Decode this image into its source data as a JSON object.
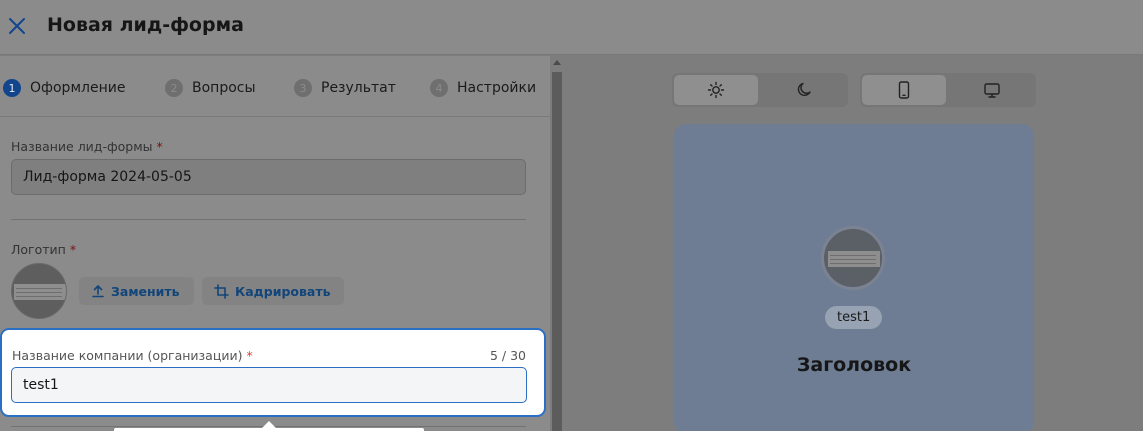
{
  "header": {
    "title": "Новая лид-форма"
  },
  "steps": [
    {
      "num": "1",
      "label": "Оформление",
      "active": true
    },
    {
      "num": "2",
      "label": "Вопросы",
      "active": false
    },
    {
      "num": "3",
      "label": "Результат",
      "active": false
    },
    {
      "num": "4",
      "label": "Настройки",
      "active": false
    }
  ],
  "form": {
    "name_label": "Название лид-формы",
    "name_value": "Лид-форма 2024-05-05",
    "logo_label": "Логотип",
    "replace_label": "Заменить",
    "crop_label": "Кадрировать",
    "company_label": "Название компании (организации)",
    "company_value": "test1",
    "company_counter": "5 / 30",
    "required_mark": "*"
  },
  "preview": {
    "company_name": "test1",
    "heading": "Заголовок"
  },
  "colors": {
    "accent": "#2a6fc4",
    "active_step": "#12458c",
    "required": "#e03a3a"
  }
}
